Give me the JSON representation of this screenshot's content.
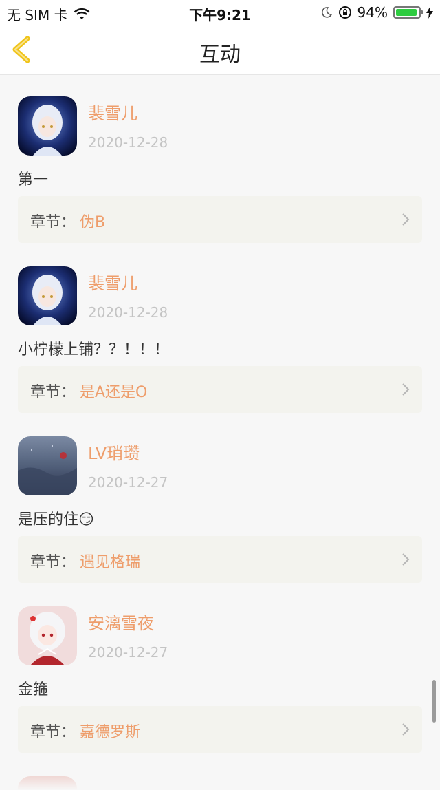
{
  "status_bar": {
    "carrier": "无 SIM 卡",
    "time": "下午9:21",
    "battery": "94%",
    "battery_level": 0.94
  },
  "nav": {
    "title": "互动"
  },
  "comments": [
    {
      "name": "裴雪儿",
      "date": "2020-12-28",
      "text": "第一",
      "chapter_prefix": "章节：",
      "chapter": "伪B",
      "avatar": "avatar-anime-blue"
    },
    {
      "name": "裴雪儿",
      "date": "2020-12-28",
      "text": "小柠檬上铺？？！！！",
      "chapter_prefix": "章节：",
      "chapter": "是A还是O",
      "avatar": "avatar-anime-blue"
    },
    {
      "name": "LV琑瓒",
      "date": "2020-12-27",
      "text": "是压的住😏",
      "chapter_prefix": "章节：",
      "chapter": "遇见格瑞",
      "avatar": "avatar-night-landscape"
    },
    {
      "name": "安漓雪夜",
      "date": "2020-12-27",
      "text": "金箍",
      "chapter_prefix": "章节：",
      "chapter": "嘉德罗斯",
      "avatar": "avatar-anime-red"
    }
  ],
  "colors": {
    "accent": "#ee9d6b",
    "date": "#c4c4c4",
    "chapter_bg": "#f3f3ee",
    "back_icon": "#f0c419"
  }
}
